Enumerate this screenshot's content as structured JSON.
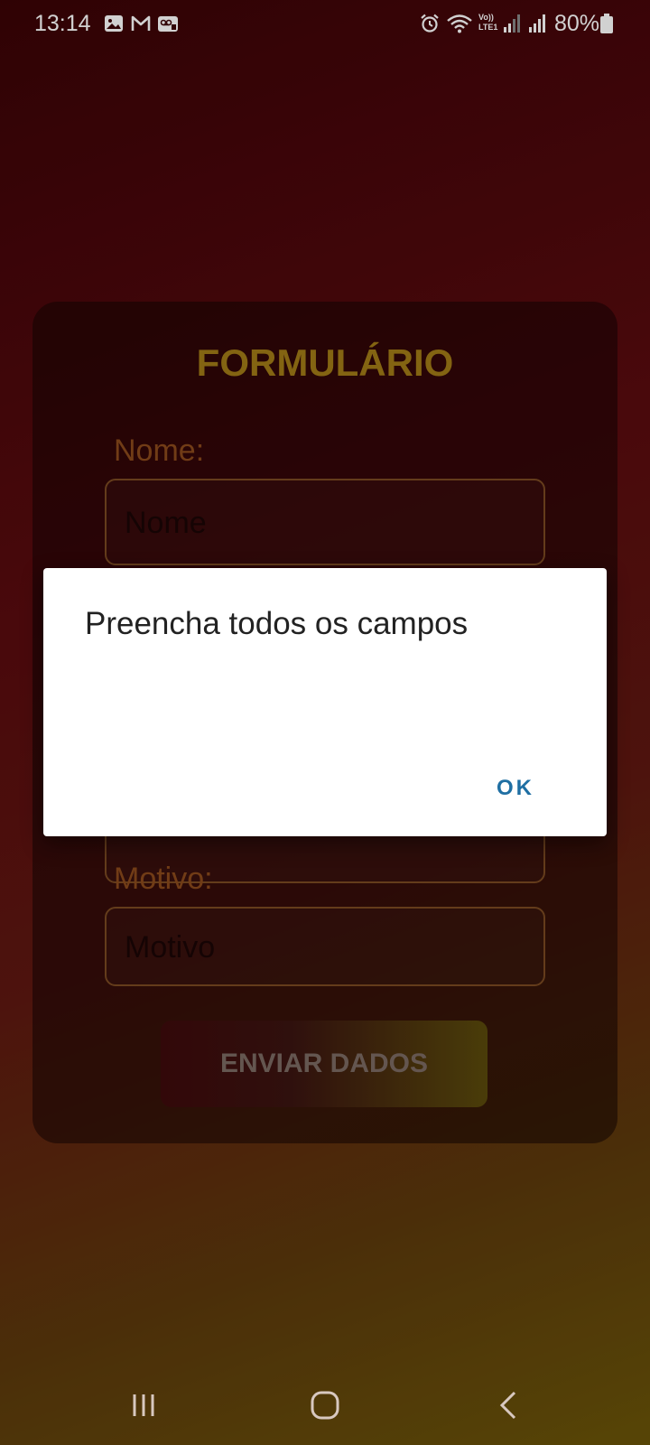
{
  "status_bar": {
    "time": "13:14",
    "battery": "80%",
    "network": "Vo)) LTE1"
  },
  "form": {
    "title": "FORMULÁRIO",
    "fields": [
      {
        "label": "Nome:",
        "value": "Nome"
      },
      {
        "label": "Motivo:",
        "value": "Motivo"
      }
    ],
    "submit_label": "ENVIAR DADOS"
  },
  "dialog": {
    "message": "Preencha todos os campos",
    "ok_label": "OK"
  },
  "colors": {
    "accent_title": "#a07a16",
    "dialog_button": "#1f6fa3"
  },
  "icons": {
    "status_left": [
      "gallery-icon",
      "gmail-icon",
      "voicemail-icon"
    ],
    "status_right": [
      "alarm-icon",
      "wifi-icon",
      "signal-icon",
      "signal-icon",
      "battery-icon"
    ],
    "nav": [
      "recents-icon",
      "home-icon",
      "back-icon"
    ]
  }
}
